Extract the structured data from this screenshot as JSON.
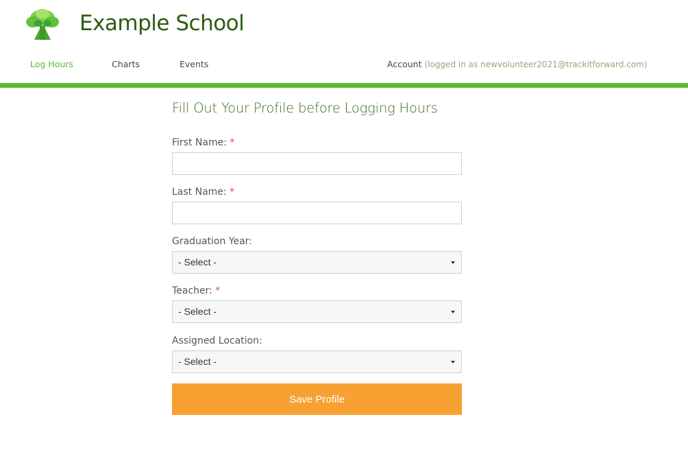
{
  "header": {
    "site_title": "Example School",
    "logo_icon": "tree-logo-icon"
  },
  "nav": {
    "items": [
      {
        "label": "Log Hours",
        "active": true
      },
      {
        "label": "Charts",
        "active": false
      },
      {
        "label": "Events",
        "active": false
      }
    ],
    "account_label": "Account",
    "logged_in_text": "(logged in as newvolunteer2021@trackitforward.com)"
  },
  "colors": {
    "accent_green": "#5bbb37",
    "title_green": "#2f5a0f",
    "button_orange": "#f7a133",
    "required_red": "#e04848"
  },
  "form": {
    "title": "Fill Out Your Profile before Logging Hours",
    "required_mark": "*",
    "first_name": {
      "label": "First Name:",
      "value": "",
      "required": true
    },
    "last_name": {
      "label": "Last Name:",
      "value": "",
      "required": true
    },
    "graduation_year": {
      "label": "Graduation Year:",
      "selected": "- Select -",
      "required": false
    },
    "teacher": {
      "label": "Teacher:",
      "selected": "- Select -",
      "required": true
    },
    "assigned_location": {
      "label": "Assigned Location:",
      "selected": "- Select -",
      "required": false
    },
    "save_label": "Save Profile"
  }
}
